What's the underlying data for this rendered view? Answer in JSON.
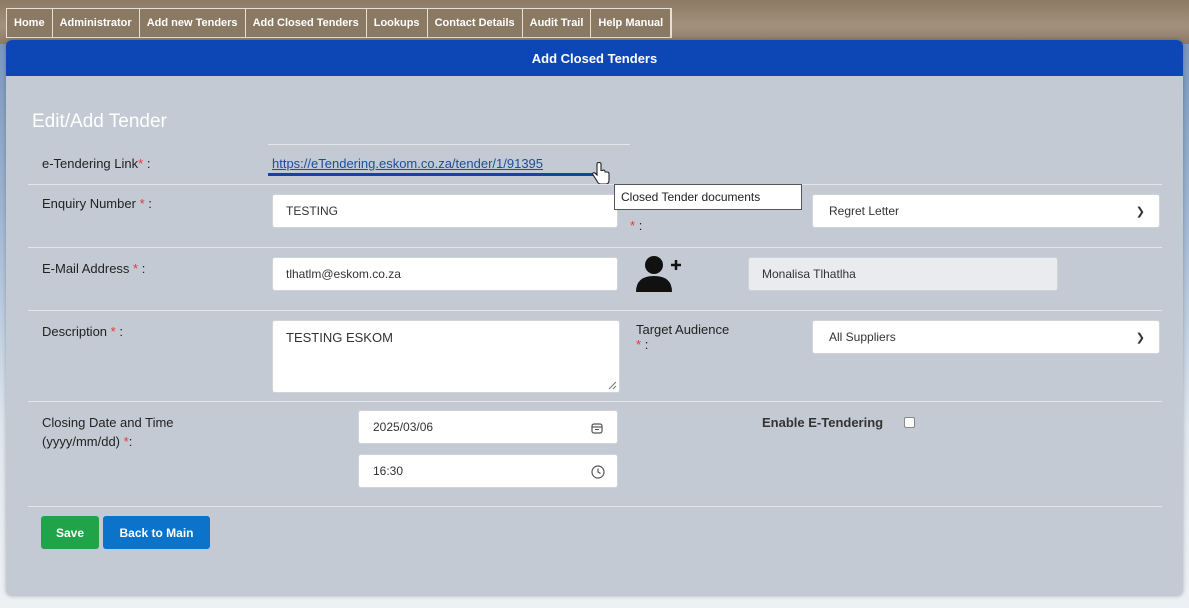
{
  "menu": {
    "items": [
      "Home",
      "Administrator",
      "Add new Tenders",
      "Add Closed Tenders",
      "Lookups",
      "Contact Details",
      "Audit Trail",
      "Help Manual"
    ]
  },
  "panel": {
    "header": "Add Closed Tenders",
    "section_title": "Edit/Add Tender"
  },
  "form": {
    "etender_label": "e-Tendering Link",
    "etender_link": "https://eTendering.eskom.co.za/tender/1/91395",
    "tooltip": "Closed Tender documents",
    "enquiry_label": "Enquiry Number",
    "enquiry_value": "TESTING",
    "letter_value": "Regret Letter",
    "email_label": "E-Mail Address",
    "email_value": "tlhatlm@eskom.co.za",
    "contact_name": "Monalisa Tlhatlha",
    "description_label": "Description",
    "description_value": "TESTING ESKOM",
    "target_label": "Target Audience",
    "target_value": "All Suppliers",
    "closing_label_line1": "Closing Date and Time",
    "closing_label_line2": "(yyyy/mm/dd)",
    "date_value": "2025/03/06",
    "time_value": "16:30",
    "enable_label": "Enable E-Tendering",
    "required_marker": "*",
    "colon": ":"
  },
  "buttons": {
    "save": "Save",
    "back": "Back to Main"
  },
  "icons": {
    "add_user": "add-user-icon",
    "calendar": "calendar-icon",
    "clock": "clock-icon",
    "chevron": "chevron-down-icon",
    "cursor": "hand-pointer-icon"
  },
  "colors": {
    "header_blue": "#0d47b5",
    "save_green": "#21a34a",
    "back_blue": "#0b73c9",
    "required_red": "#e53935"
  }
}
